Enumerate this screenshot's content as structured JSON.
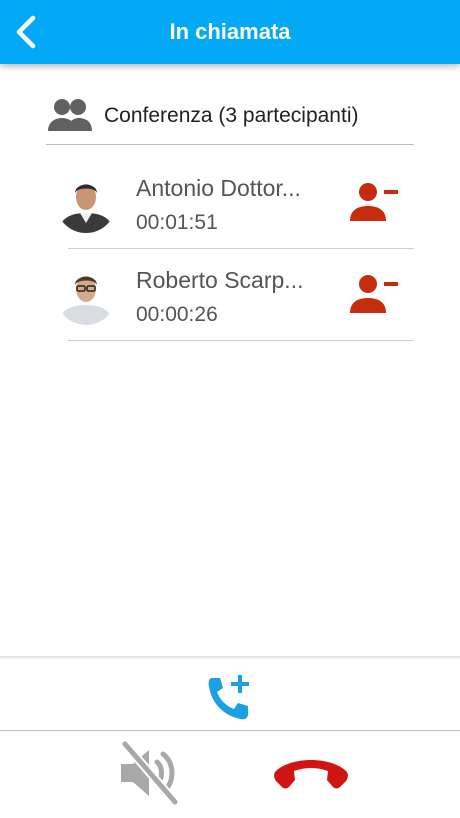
{
  "header": {
    "title": "In chiamata",
    "back_icon": "chevron-left-icon"
  },
  "conference": {
    "label": "Conferenza (3 partecipanti)",
    "icon": "group-icon"
  },
  "participants": [
    {
      "name": "Antonio Dottor...",
      "duration": "00:01:51",
      "remove_icon": "remove-person-icon"
    },
    {
      "name": "Roberto Scarp...",
      "duration": "00:00:26",
      "remove_icon": "remove-person-icon"
    }
  ],
  "controls": {
    "add_call_icon": "phone-add-icon",
    "mute_icon": "speaker-muted-icon",
    "hangup_icon": "hang-up-icon"
  },
  "colors": {
    "accent": "#03a9f4",
    "remove": "#c62d0e",
    "hangup": "#d01414",
    "muted_gray": "#a8a8a8"
  }
}
